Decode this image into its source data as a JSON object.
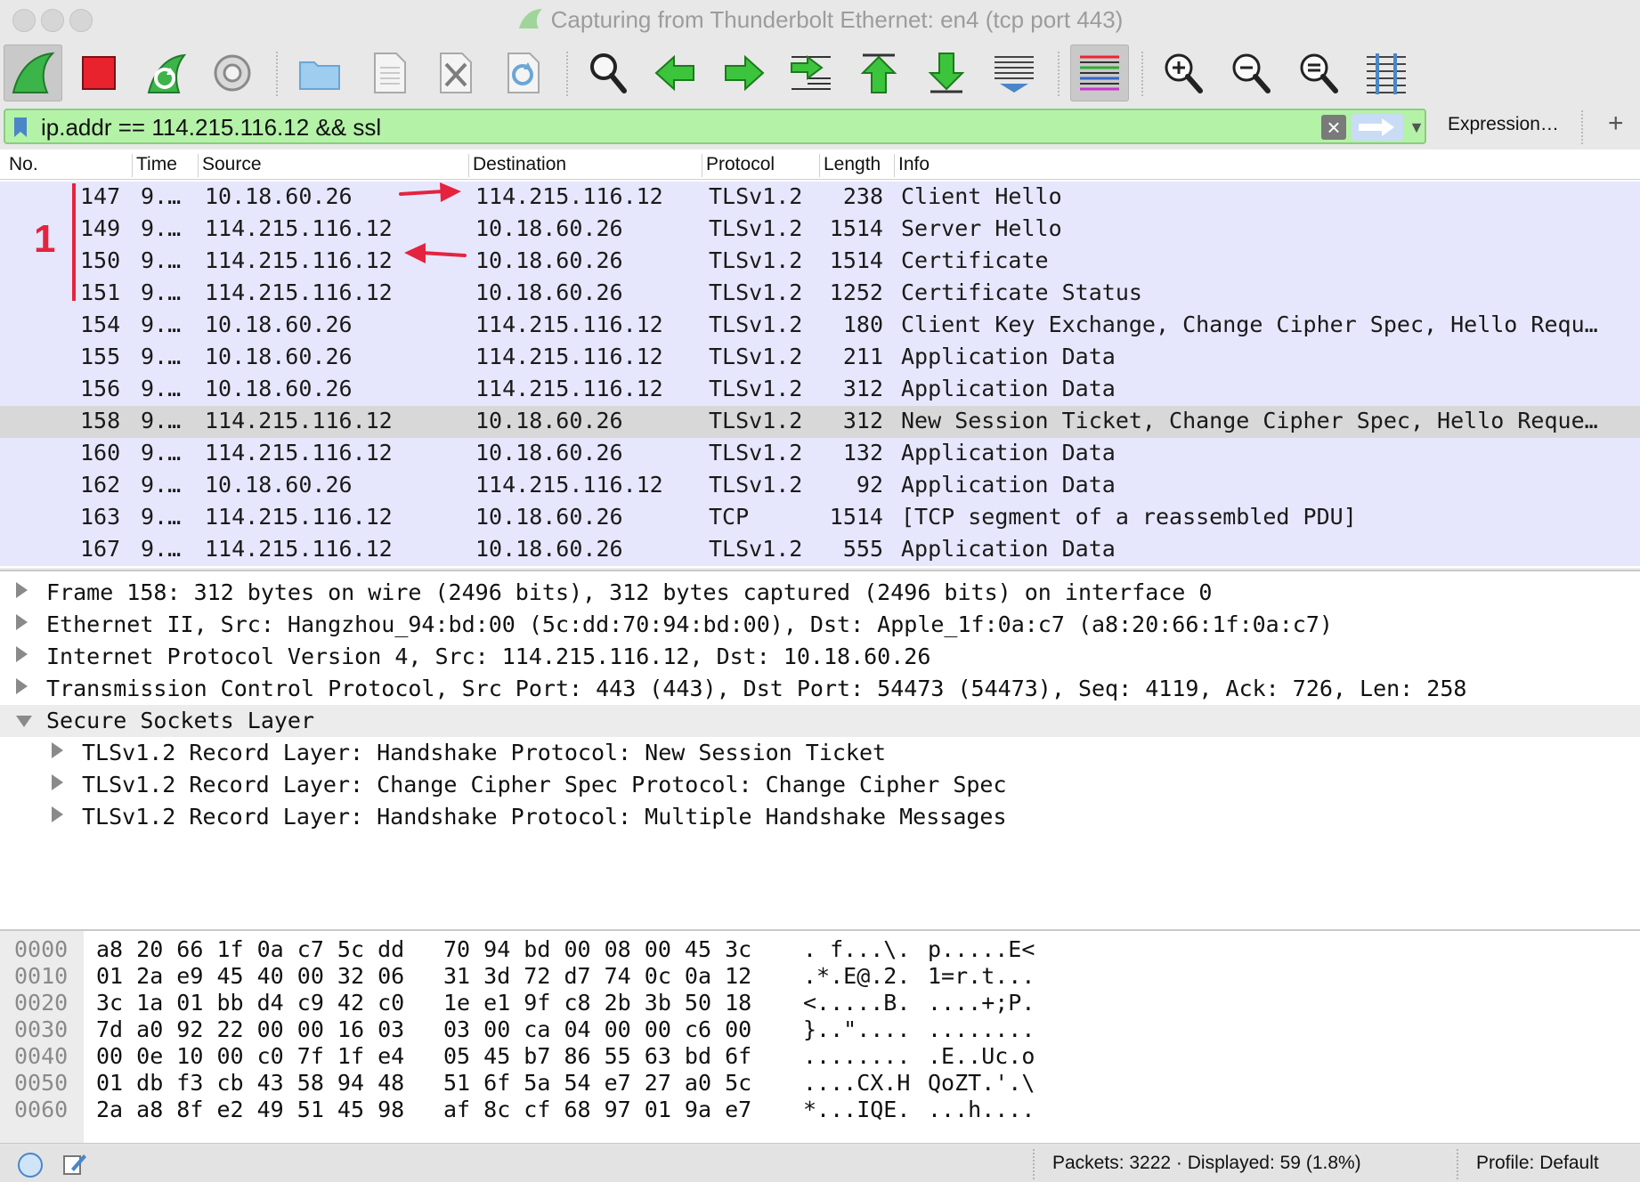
{
  "window": {
    "title": "Capturing from Thunderbolt Ethernet: en4 (tcp port 443)"
  },
  "toolbar": {
    "icons": [
      "start-capture-icon",
      "stop-capture-icon",
      "restart-capture-icon",
      "capture-options-icon",
      "open-file-icon",
      "save-file-icon",
      "close-file-icon",
      "reload-file-icon",
      "find-packet-icon",
      "go-back-icon",
      "go-forward-icon",
      "go-to-packet-icon",
      "go-first-icon",
      "go-last-icon",
      "autoscroll-icon",
      "colorize-icon",
      "zoom-in-icon",
      "zoom-out-icon",
      "zoom-normal-icon",
      "resize-columns-icon"
    ]
  },
  "filter": {
    "value": "ip.addr == 114.215.116.12 && ssl",
    "expression_label": "Expression…",
    "plus_label": "+"
  },
  "colors": {
    "row_bg": "#e6e7fc",
    "row_selected": "#d8d8d8",
    "filter_valid": "#b3f2a7",
    "annotation": "#e4243f"
  },
  "packet_list": {
    "columns": [
      "No.",
      "Time",
      "Source",
      "Destination",
      "Protocol",
      "Length",
      "Info"
    ],
    "annotation_number": "1",
    "rows": [
      {
        "no": "147",
        "time": "9.…",
        "src": "10.18.60.26",
        "dst": "114.215.116.12",
        "proto": "TLSv1.2",
        "len": "238",
        "info": "Client Hello"
      },
      {
        "no": "149",
        "time": "9.…",
        "src": "114.215.116.12",
        "dst": "10.18.60.26",
        "proto": "TLSv1.2",
        "len": "1514",
        "info": "Server Hello"
      },
      {
        "no": "150",
        "time": "9.…",
        "src": "114.215.116.12",
        "dst": "10.18.60.26",
        "proto": "TLSv1.2",
        "len": "1514",
        "info": "Certificate"
      },
      {
        "no": "151",
        "time": "9.…",
        "src": "114.215.116.12",
        "dst": "10.18.60.26",
        "proto": "TLSv1.2",
        "len": "1252",
        "info": "Certificate Status"
      },
      {
        "no": "154",
        "time": "9.…",
        "src": "10.18.60.26",
        "dst": "114.215.116.12",
        "proto": "TLSv1.2",
        "len": "180",
        "info": "Client Key Exchange, Change Cipher Spec, Hello Requ…"
      },
      {
        "no": "155",
        "time": "9.…",
        "src": "10.18.60.26",
        "dst": "114.215.116.12",
        "proto": "TLSv1.2",
        "len": "211",
        "info": "Application Data"
      },
      {
        "no": "156",
        "time": "9.…",
        "src": "10.18.60.26",
        "dst": "114.215.116.12",
        "proto": "TLSv1.2",
        "len": "312",
        "info": "Application Data"
      },
      {
        "no": "158",
        "time": "9.…",
        "src": "114.215.116.12",
        "dst": "10.18.60.26",
        "proto": "TLSv1.2",
        "len": "312",
        "info": "New Session Ticket, Change Cipher Spec, Hello Reque…"
      },
      {
        "no": "160",
        "time": "9.…",
        "src": "114.215.116.12",
        "dst": "10.18.60.26",
        "proto": "TLSv1.2",
        "len": "132",
        "info": "Application Data"
      },
      {
        "no": "162",
        "time": "9.…",
        "src": "10.18.60.26",
        "dst": "114.215.116.12",
        "proto": "TLSv1.2",
        "len": "92",
        "info": "Application Data"
      },
      {
        "no": "163",
        "time": "9.…",
        "src": "114.215.116.12",
        "dst": "10.18.60.26",
        "proto": "TCP",
        "len": "1514",
        "info": "[TCP segment of a reassembled PDU]"
      },
      {
        "no": "167",
        "time": "9.…",
        "src": "114.215.116.12",
        "dst": "10.18.60.26",
        "proto": "TLSv1.2",
        "len": "555",
        "info": "Application Data"
      }
    ]
  },
  "details": {
    "items": [
      "Frame 158: 312 bytes on wire (2496 bits), 312 bytes captured (2496 bits) on interface 0",
      "Ethernet II, Src: Hangzhou_94:bd:00 (5c:dd:70:94:bd:00), Dst: Apple_1f:0a:c7 (a8:20:66:1f:0a:c7)",
      "Internet Protocol Version 4, Src: 114.215.116.12, Dst: 10.18.60.26",
      "Transmission Control Protocol, Src Port: 443 (443), Dst Port: 54473 (54473), Seq: 4119, Ack: 726, Len: 258",
      "Secure Sockets Layer"
    ],
    "children": [
      "TLSv1.2 Record Layer: Handshake Protocol: New Session Ticket",
      "TLSv1.2 Record Layer: Change Cipher Spec Protocol: Change Cipher Spec",
      "TLSv1.2 Record Layer: Handshake Protocol: Multiple Handshake Messages"
    ]
  },
  "bytes": {
    "rows": [
      {
        "off": "0000",
        "h1": "a8 20 66 1f 0a c7 5c dd",
        "h2": "70 94 bd 00 08 00 45 3c",
        "a1": ". f...\\.",
        "a2": "p.....E<"
      },
      {
        "off": "0010",
        "h1": "01 2a e9 45 40 00 32 06",
        "h2": "31 3d 72 d7 74 0c 0a 12",
        "a1": ".*.E@.2.",
        "a2": "1=r.t..."
      },
      {
        "off": "0020",
        "h1": "3c 1a 01 bb d4 c9 42 c0",
        "h2": "1e e1 9f c8 2b 3b 50 18",
        "a1": "<.....B.",
        "a2": "....+;P."
      },
      {
        "off": "0030",
        "h1": "7d a0 92 22 00 00 16 03",
        "h2": "03 00 ca 04 00 00 c6 00",
        "a1": "}..\"....",
        "a2": "........"
      },
      {
        "off": "0040",
        "h1": "00 0e 10 00 c0 7f 1f e4",
        "h2": "05 45 b7 86 55 63 bd 6f",
        "a1": "........",
        "a2": ".E..Uc.o"
      },
      {
        "off": "0050",
        "h1": "01 db f3 cb 43 58 94 48",
        "h2": "51 6f 5a 54 e7 27 a0 5c",
        "a1": "....CX.H",
        "a2": "QoZT.'.\\"
      },
      {
        "off": "0060",
        "h1": "2a a8 8f e2 49 51 45 98",
        "h2": "af 8c cf 68 97 01 9a e7",
        "a1": "*...IQE.",
        "a2": "...h...."
      }
    ]
  },
  "status": {
    "packets": "Packets: 3222 · Displayed: 59 (1.8%)",
    "profile": "Profile: Default"
  }
}
